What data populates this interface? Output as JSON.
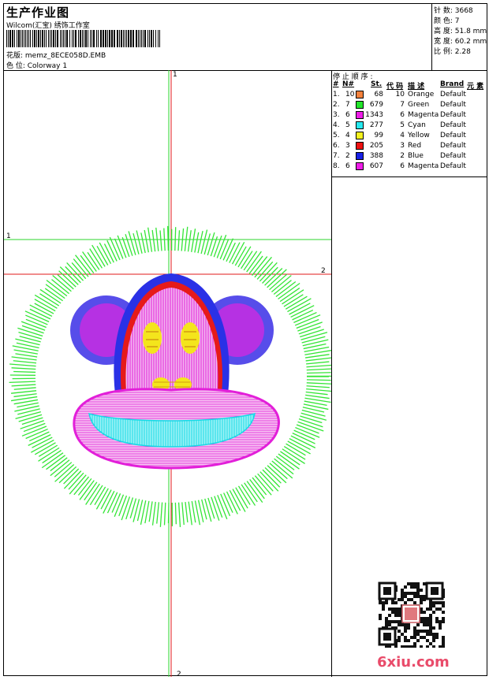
{
  "header": {
    "title": "生产作业图",
    "company": "Wilcom(汇宝) 绣饰工作室",
    "design_label": "花版: ",
    "design_name": "memz_8ECE058D.EMB",
    "colorway_label": "色 位: ",
    "colorway": "Colorway 1"
  },
  "stats": {
    "stitches": "针 数: 3668",
    "colors": "颜 色: 7",
    "height": "高 度: 51.8 mm",
    "width": "宽 度: 60.2 mm",
    "ratio": "比 例: 2.28"
  },
  "sequence": {
    "title": "停 止 顺 序 :",
    "col_num": "#",
    "col_n": "N#",
    "col_st": "St.",
    "col_code": "代 码",
    "col_desc": "描 述",
    "col_brand": "Brand",
    "col_elem": "元 素",
    "rows": [
      {
        "idx": "1.",
        "n": "10",
        "st": "68",
        "code": "10",
        "desc": "Orange",
        "brand": "Default",
        "color": "#f4813c"
      },
      {
        "idx": "2.",
        "n": "7",
        "st": "679",
        "code": "7",
        "desc": "Green",
        "brand": "Default",
        "color": "#22e52b"
      },
      {
        "idx": "3.",
        "n": "6",
        "st": "1343",
        "code": "6",
        "desc": "Magenta",
        "brand": "Default",
        "color": "#ef1ce8"
      },
      {
        "idx": "4.",
        "n": "5",
        "st": "277",
        "code": "5",
        "desc": "Cyan",
        "brand": "Default",
        "color": "#26e9ef"
      },
      {
        "idx": "5.",
        "n": "4",
        "st": "99",
        "code": "4",
        "desc": "Yellow",
        "brand": "Default",
        "color": "#f4f21e"
      },
      {
        "idx": "6.",
        "n": "3",
        "st": "205",
        "code": "3",
        "desc": "Red",
        "brand": "Default",
        "color": "#ee1111"
      },
      {
        "idx": "7.",
        "n": "2",
        "st": "388",
        "code": "2",
        "desc": "Blue",
        "brand": "Default",
        "color": "#1820e6"
      },
      {
        "idx": "8.",
        "n": "6",
        "st": "607",
        "code": "6",
        "desc": "Magenta",
        "brand": "Default",
        "color": "#ef1ce8"
      }
    ]
  },
  "markers": {
    "v_top": "1",
    "v_bottom": "2",
    "h_green": "1",
    "h_red": "2"
  },
  "footer": {
    "site": "6xiu.com"
  }
}
